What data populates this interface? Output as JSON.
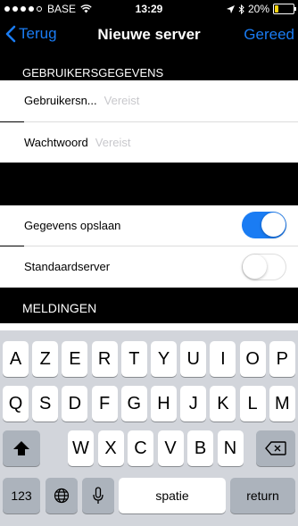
{
  "status_bar": {
    "carrier": "BASE",
    "time": "13:29",
    "battery": "20%",
    "battery_level": 0.2
  },
  "nav": {
    "back_label": "Terug",
    "title": "Nieuwe server",
    "done_label": "Gereed"
  },
  "sections": {
    "credentials_header": "GEBRUIKERSGEGEVENS",
    "notifications_header": "MELDINGEN"
  },
  "fields": {
    "username": {
      "label": "Gebruikersn...",
      "placeholder": "Vereist"
    },
    "password": {
      "label": "Wachtwoord",
      "placeholder": "Vereist"
    }
  },
  "toggles": {
    "save_data": {
      "label": "Gegevens opslaan",
      "on": true
    },
    "default_server": {
      "label": "Standaardserver",
      "on": false
    },
    "notifications": {
      "on": true
    }
  },
  "keyboard": {
    "row1": [
      "A",
      "Z",
      "E",
      "R",
      "T",
      "Y",
      "U",
      "I",
      "O",
      "P"
    ],
    "row2": [
      "Q",
      "S",
      "D",
      "F",
      "G",
      "H",
      "J",
      "K",
      "L",
      "M"
    ],
    "row3": [
      "W",
      "X",
      "C",
      "V",
      "B",
      "N"
    ],
    "numbers_key": "123",
    "space_key": "spatie",
    "return_key": "return"
  },
  "icons": {
    "shift": "shift-arrow-icon",
    "backspace": "backspace-icon",
    "globe": "globe-icon",
    "mic": "microphone-icon",
    "location": "location-arrow-icon",
    "bluetooth": "bluetooth-icon",
    "wifi": "wifi-icon"
  }
}
